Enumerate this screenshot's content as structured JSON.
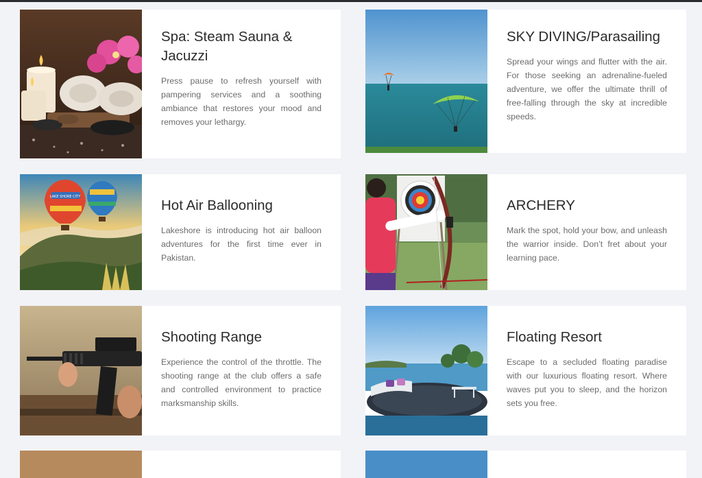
{
  "cards": [
    {
      "title": "Spa: Steam Sauna & Jacuzzi",
      "description": "Press pause to refresh yourself with pampering services and a soothing ambiance that restores your mood and removes your lethargy.",
      "image_icon": "spa-photo"
    },
    {
      "title": "SKY DIVING/Parasailing",
      "description": "Spread your wings and flutter with the air. For those seeking an adrenaline-fueled adventure, we offer the ultimate thrill of free-falling through the sky at incredible speeds.",
      "image_icon": "paragliding-photo"
    },
    {
      "title": "Hot Air Ballooning",
      "description": "Lakeshore is introducing hot air balloon adventures for the first time ever in Pakistan.",
      "image_icon": "hot-air-balloon-photo"
    },
    {
      "title": "ARCHERY",
      "description": "Mark the spot, hold your bow, and unleash the warrior inside. Don’t fret about your learning pace.",
      "image_icon": "archery-photo"
    },
    {
      "title": "Shooting Range",
      "description": "Experience the control of the throttle. The shooting range at the club offers a safe and controlled environment to practice marksmanship skills.",
      "image_icon": "rifle-photo"
    },
    {
      "title": "Floating Resort",
      "description": "Escape to a secluded floating paradise with our luxurious floating resort. Where waves put you to sleep, and the horizon sets you free.",
      "image_icon": "floating-resort-photo"
    }
  ],
  "balloon_text": "LAKE SHORE CITY"
}
